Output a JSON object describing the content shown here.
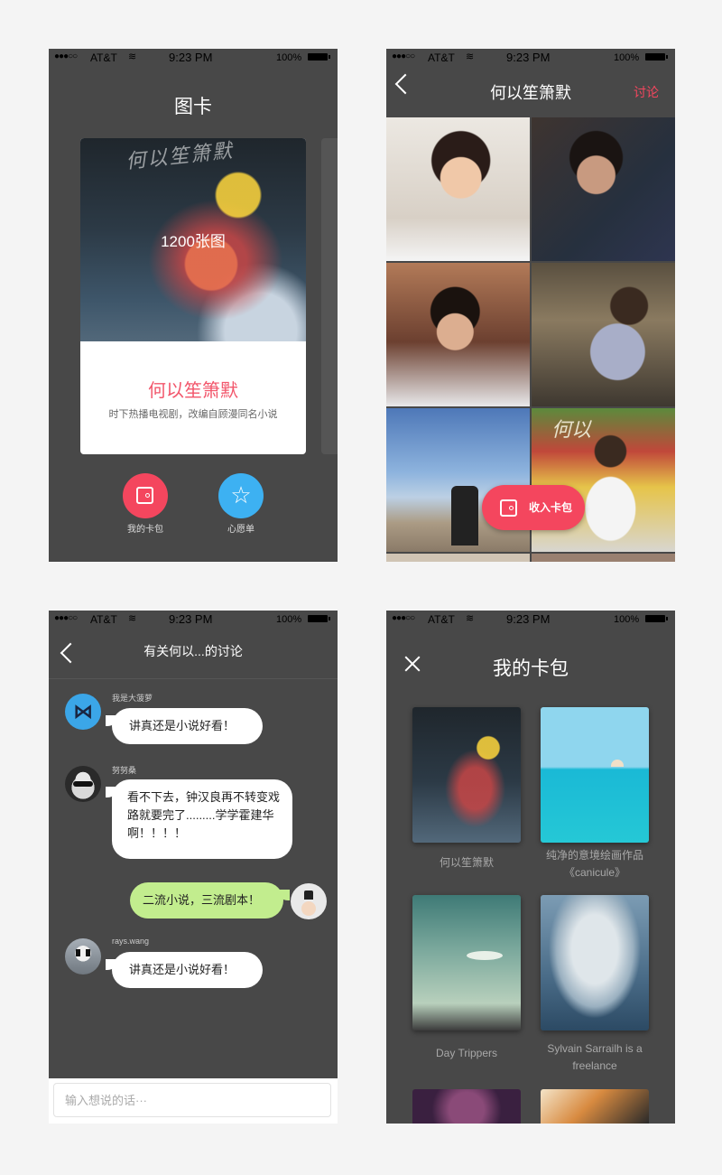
{
  "status": {
    "signal": "●●●○○",
    "carrier": "AT&T",
    "wifi": "≋",
    "time": "9:23 PM",
    "battery": "100%"
  },
  "screen1": {
    "title": "图卡",
    "card": {
      "image_text": "何以笙箫默",
      "count": "1200张图",
      "name": "何以笙箫默",
      "desc": "时下热播电视剧，改编自顾漫同名小说"
    },
    "buttons": [
      {
        "label": "我的卡包",
        "icon": "wallet-icon",
        "color": "#f4465e"
      },
      {
        "label": "心愿单",
        "icon": "star-icon",
        "color": "#3db1f2"
      }
    ]
  },
  "screen2": {
    "title": "何以笙箫默",
    "action": "讨论",
    "action_color": "#f4465e",
    "tile6_text": "何以",
    "collect_label": "收入卡包"
  },
  "screen3": {
    "title": "有关何以...的讨论",
    "messages": [
      {
        "user": "我是大菠萝",
        "text": "讲真还是小说好看！",
        "side": "left"
      },
      {
        "user": "努努桑",
        "text": "看不下去，钟汉良再不转变戏路就要完了.........学学霍建华啊！！！！",
        "side": "left"
      },
      {
        "user": "",
        "text": "二流小说，三流剧本！",
        "side": "right"
      },
      {
        "user": "rays.wang",
        "text": "讲真还是小说好看！",
        "side": "left"
      }
    ],
    "input_placeholder": "输入想说的话···"
  },
  "screen4": {
    "title": "我的卡包",
    "cards": [
      {
        "label": "何以笙箫默"
      },
      {
        "label": "纯净的意境绘画作品《canicule》"
      },
      {
        "label": "Day Trippers"
      },
      {
        "label": "Sylvain Sarrailh is a freelance"
      }
    ]
  }
}
